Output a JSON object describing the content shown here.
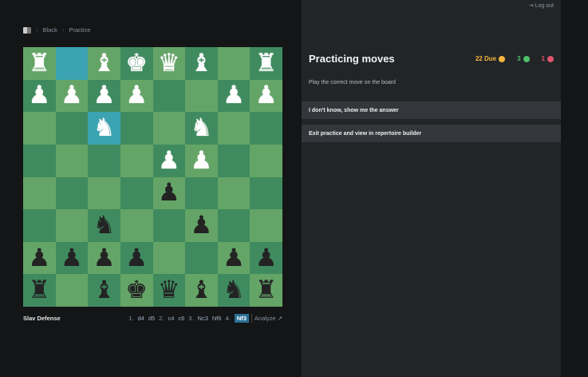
{
  "breadcrumb": {
    "items": [
      "Black",
      "Practice"
    ]
  },
  "board": {
    "ranks": [
      [
        "wR",
        "",
        "wB",
        "wK",
        "wQ",
        "wB",
        "",
        "wR"
      ],
      [
        "wP",
        "wP",
        "wP",
        "wP",
        "",
        "",
        "wP",
        "wP"
      ],
      [
        "",
        "",
        "wN",
        "",
        "",
        "wN",
        "",
        ""
      ],
      [
        "",
        "",
        "",
        "",
        "wP",
        "wP",
        "",
        ""
      ],
      [
        "",
        "",
        "",
        "",
        "bP",
        "",
        "",
        ""
      ],
      [
        "",
        "",
        "bN",
        "",
        "",
        "bP",
        "",
        ""
      ],
      [
        "bP",
        "bP",
        "bP",
        "bP",
        "",
        "",
        "bP",
        "bP"
      ],
      [
        "bR",
        "",
        "bB",
        "bK",
        "bQ",
        "bB",
        "bN",
        "bR"
      ]
    ],
    "highlight": [
      [
        0,
        1
      ],
      [
        2,
        2
      ]
    ],
    "colors": {
      "light": "#64a567",
      "dark": "#3f8b5f",
      "highlight": "#3ba3b1"
    }
  },
  "footer": {
    "opening": "Slav Defense",
    "moves": [
      "1.",
      "d4",
      "d5",
      "2.",
      "c4",
      "c6",
      "3.",
      "Nc3",
      "Nf6",
      "4.",
      "Nf3"
    ],
    "analyze": "Analyze"
  },
  "panel": {
    "logout": "Log out",
    "title": "Practicing moves",
    "due": "22 Due",
    "correct": "3",
    "incorrect": "1",
    "instruction": "Play the correct move on the board",
    "show_answer": "I don't know, show me the answer",
    "exit": "Exit practice and view in repertoire builder",
    "colors": {
      "due": "#f4b63f",
      "correct": "#4fbf6a",
      "incorrect": "#e2546c"
    }
  }
}
